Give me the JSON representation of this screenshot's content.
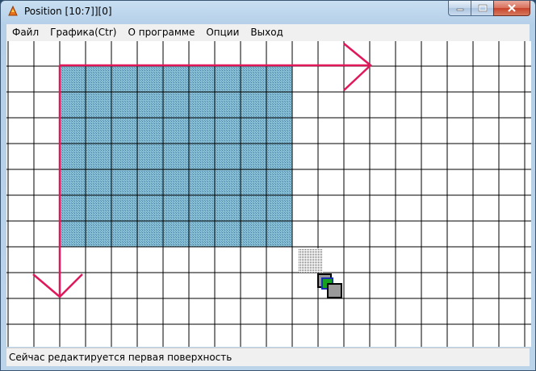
{
  "window": {
    "title": "Position [10:7]][0]",
    "controls": {
      "minimize": "minimize",
      "maximize": "maximize",
      "close": "close"
    }
  },
  "menu": {
    "items": [
      {
        "label": "Файл"
      },
      {
        "label": "Графика(Ctr)"
      },
      {
        "label": "О программе"
      },
      {
        "label": "Опции"
      },
      {
        "label": "Выход"
      }
    ]
  },
  "status": {
    "text": "Сейчас редактируется первая поверхность"
  },
  "colors": {
    "grid_line": "#000000",
    "surface_fill": "#7fb8cf",
    "arrow": "#e0185a",
    "cursor_frame": "#000000",
    "cursor_green": "#18a020",
    "cursor_blue": "#1a2fb0",
    "cursor_gray": "#9a9a9a"
  },
  "icons": {
    "app": "app-icon"
  }
}
